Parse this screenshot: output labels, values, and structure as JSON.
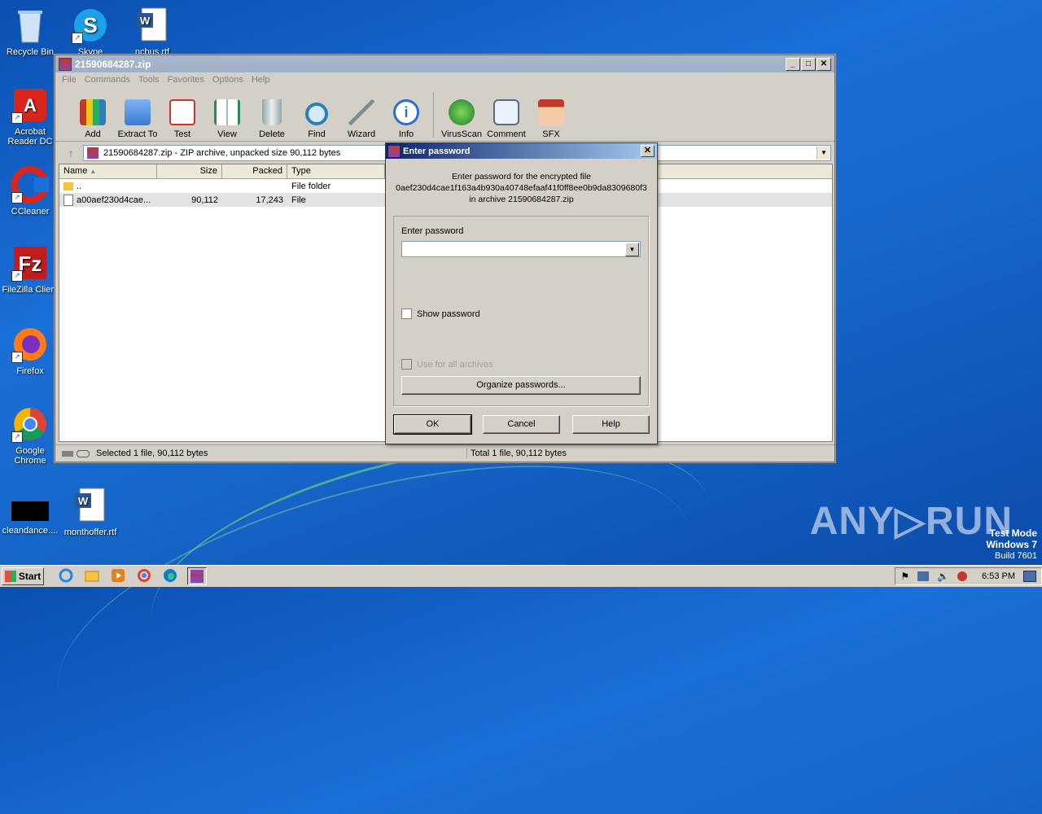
{
  "desktop": {
    "icons": [
      {
        "label": "Recycle Bin"
      },
      {
        "label": "Skype"
      },
      {
        "label": "ncbus.rtf"
      },
      {
        "label": "Acrobat Reader DC"
      },
      {
        "label": "CCleaner"
      },
      {
        "label": "FileZilla Client"
      },
      {
        "label": "Firefox"
      },
      {
        "label": "Google Chrome"
      },
      {
        "label": "cleandance...."
      },
      {
        "label": "monthoffer.rtf"
      }
    ],
    "watermark": "ANY▷RUN",
    "test_mode": {
      "line1": "Test Mode",
      "line2": "Windows 7",
      "line3": "Build 7601"
    }
  },
  "window": {
    "title": "21590684287.zip",
    "menu": [
      "File",
      "Commands",
      "Tools",
      "Favorites",
      "Options",
      "Help"
    ],
    "toolbar": [
      {
        "label": "Add",
        "icon": "add-archive-icon",
        "color": "#c0392b"
      },
      {
        "label": "Extract To",
        "icon": "folder-icon",
        "color": "#3a7bd5"
      },
      {
        "label": "Test",
        "icon": "clipboard-check-icon",
        "color": "#c0392b"
      },
      {
        "label": "View",
        "icon": "book-icon",
        "color": "#2e8b57"
      },
      {
        "label": "Delete",
        "icon": "trash-icon",
        "color": "#7f8c8d"
      },
      {
        "label": "Find",
        "icon": "magnifier-icon",
        "color": "#2980b9"
      },
      {
        "label": "Wizard",
        "icon": "wand-icon",
        "color": "#27ae60"
      },
      {
        "label": "Info",
        "icon": "info-icon",
        "color": "#2c6fd1"
      },
      {
        "label": "VirusScan",
        "icon": "bug-icon",
        "color": "#2e9e3a"
      },
      {
        "label": "Comment",
        "icon": "comment-icon",
        "color": "#5d6d7e"
      },
      {
        "label": "SFX",
        "icon": "sfx-box-icon",
        "color": "#e67e22"
      }
    ],
    "address": "21590684287.zip - ZIP archive, unpacked size 90,112 bytes",
    "columns": [
      "Name",
      "Size",
      "Packed",
      "Type"
    ],
    "rows": [
      {
        "name": "..",
        "size": "",
        "packed": "",
        "type": "File folder"
      },
      {
        "name": "a00aef230d4cae...",
        "size": "90,112",
        "packed": "17,243",
        "type": "File"
      }
    ],
    "status_left": "Selected 1 file, 90,112 bytes",
    "status_right": "Total 1 file, 90,112 bytes"
  },
  "dialog": {
    "title": "Enter password",
    "msg1": "Enter password for the encrypted file",
    "msg2": "0aef230d4cae1f163a4b930a40748efaaf41f0ff8ee0b9da8309680f3",
    "msg3": "in archive 21590684287.zip",
    "field_label": "Enter password",
    "field_value": "",
    "show_password": "Show password",
    "use_all": "Use for all archives",
    "organize": "Organize passwords...",
    "ok": "OK",
    "cancel": "Cancel",
    "help": "Help"
  },
  "taskbar": {
    "start": "Start",
    "time": "6:53 PM"
  }
}
